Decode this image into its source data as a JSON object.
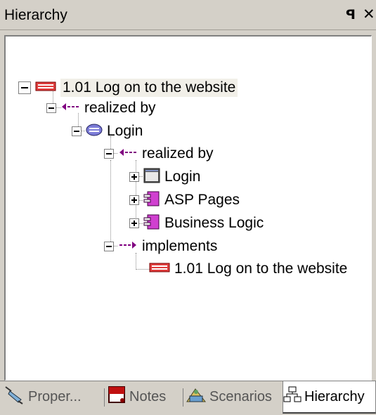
{
  "window": {
    "title": "Hierarchy",
    "pin_icon": "ꟼ",
    "close_icon": "✕"
  },
  "tree": [
    {
      "id": "n1",
      "label": "1.01 Log on to the website",
      "icon": "use-case-icon",
      "expander": "minus",
      "selected": true
    },
    {
      "id": "n2",
      "label": "realized by",
      "icon": "realization-arrow-icon",
      "expander": "minus"
    },
    {
      "id": "n3",
      "label": "Login",
      "icon": "use-case-oval-icon",
      "expander": "minus"
    },
    {
      "id": "n4",
      "label": "realized by",
      "icon": "realization-arrow-icon",
      "expander": "minus"
    },
    {
      "id": "n5",
      "label": "Login",
      "icon": "screen-icon",
      "expander": "plus"
    },
    {
      "id": "n6",
      "label": "ASP Pages",
      "icon": "component-icon",
      "expander": "plus"
    },
    {
      "id": "n7",
      "label": "Business Logic",
      "icon": "component-icon",
      "expander": "plus"
    },
    {
      "id": "n8",
      "label": "implements",
      "icon": "implements-arrow-icon",
      "expander": "minus"
    },
    {
      "id": "n9",
      "label": "1.01 Log on to the website",
      "icon": "use-case-icon",
      "expander": "none"
    }
  ],
  "tabs": [
    {
      "label": "Proper...",
      "icon": "properties-icon",
      "active": false
    },
    {
      "label": "Notes",
      "icon": "notes-icon",
      "active": false
    },
    {
      "label": "Scenarios",
      "icon": "scenarios-icon",
      "active": false
    },
    {
      "label": "Hierarchy",
      "icon": "hierarchy-icon",
      "active": true
    }
  ],
  "colors": {
    "chrome": "#d4d0c8",
    "panel": "#ffffff",
    "selection": "#f1efe8",
    "use_case": "#c00000",
    "arrow": "#800080",
    "component": "#cc33cc"
  }
}
